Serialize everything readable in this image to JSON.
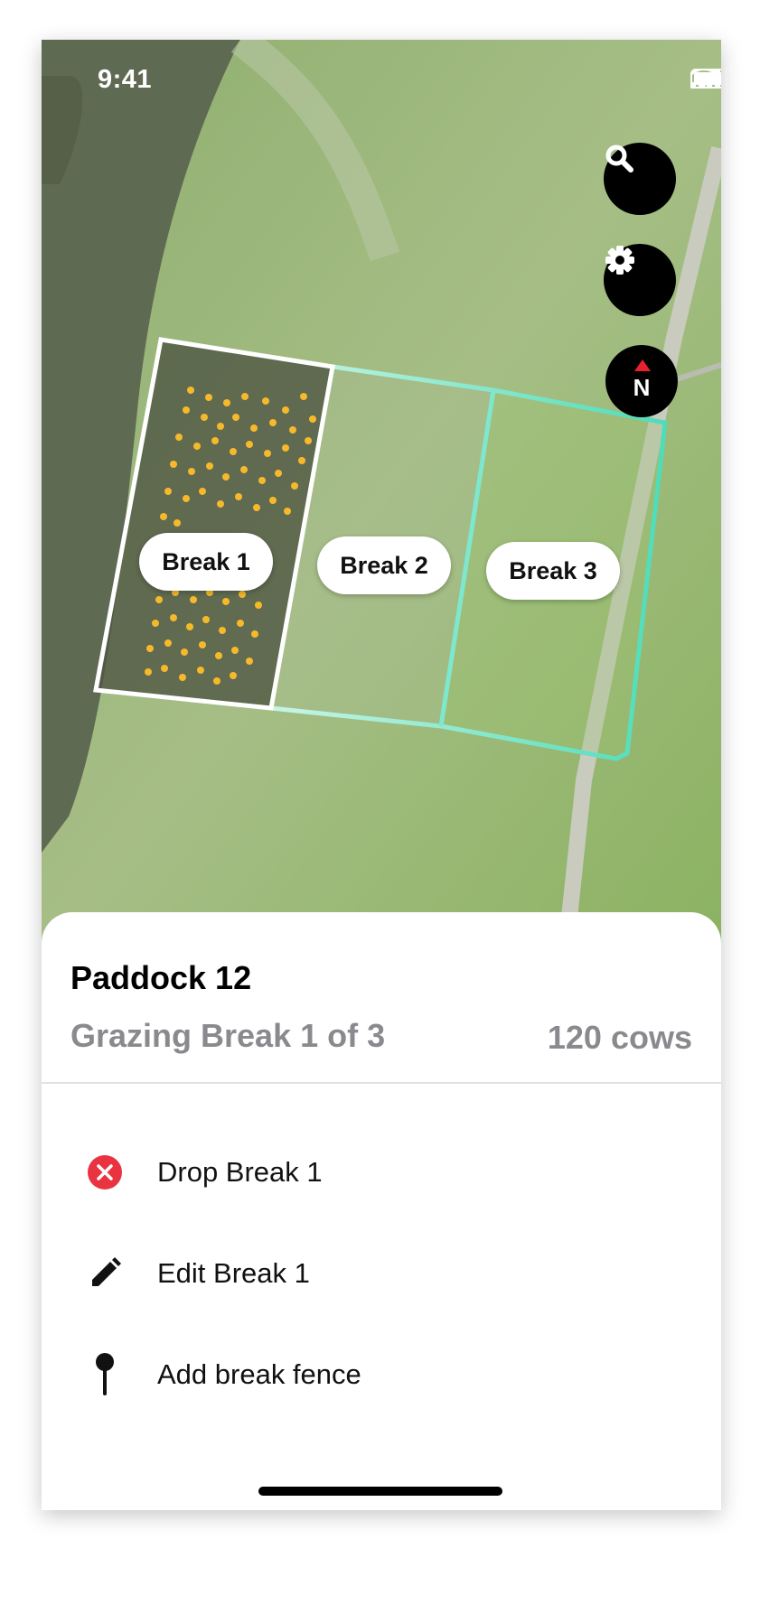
{
  "status_bar": {
    "time": "9:41"
  },
  "map": {
    "controls": {
      "search_icon": "search-icon",
      "settings_icon": "gear-icon",
      "compass_label": "N"
    },
    "breaks": [
      {
        "label": "Break 1",
        "color": "#ffffff"
      },
      {
        "label": "Break 2",
        "color": "#7ee8cf"
      },
      {
        "label": "Break 3",
        "color": "#5ce0c0"
      }
    ],
    "cow_marker_color": "#f6b92b"
  },
  "sheet": {
    "title": "Paddock 12",
    "subtitle": "Grazing Break 1 of 3",
    "count": "120 cows",
    "actions": [
      {
        "label": "Drop Break 1",
        "icon": "close-circle-icon",
        "color": "#ea3340"
      },
      {
        "label": "Edit Break 1",
        "icon": "pencil-icon"
      },
      {
        "label": "Add break fence",
        "icon": "pin-icon"
      }
    ]
  }
}
